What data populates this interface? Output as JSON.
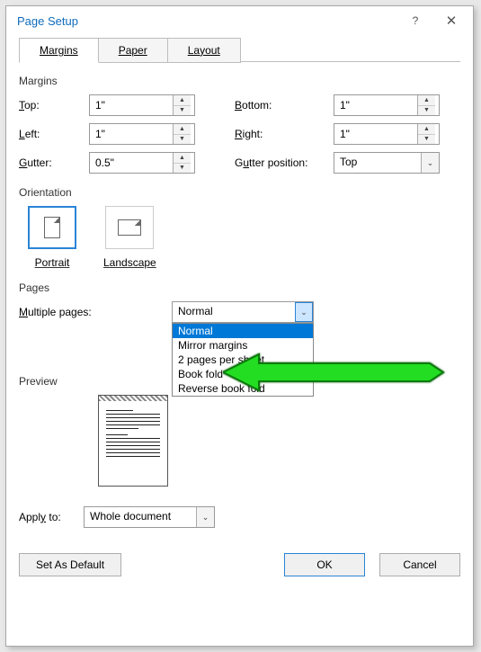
{
  "title": "Page Setup",
  "tabs": {
    "margins": "Margins",
    "paper": "Paper",
    "layout": "Layout"
  },
  "margins": {
    "title": "Margins",
    "top_lbl": "Top:",
    "top_val": "1\"",
    "bottom_lbl": "Bottom:",
    "bottom_val": "1\"",
    "left_lbl": "Left:",
    "left_val": "1\"",
    "right_lbl": "Right:",
    "right_val": "1\"",
    "gutter_lbl": "Gutter:",
    "gutter_val": "0.5\"",
    "gutter_pos_lbl": "Gutter position:",
    "gutter_pos_val": "Top"
  },
  "orientation": {
    "title": "Orientation",
    "portrait": "Portrait",
    "landscape": "Landscape"
  },
  "pages": {
    "title": "Pages",
    "multiple_lbl": "Multiple pages:",
    "multiple_val": "Normal",
    "options": [
      "Normal",
      "Mirror margins",
      "2 pages per sheet",
      "Book fold",
      "Reverse book fold"
    ]
  },
  "preview": {
    "title": "Preview"
  },
  "apply": {
    "lbl": "Apply to:",
    "val": "Whole document"
  },
  "buttons": {
    "default": "Set As Default",
    "ok": "OK",
    "cancel": "Cancel"
  }
}
